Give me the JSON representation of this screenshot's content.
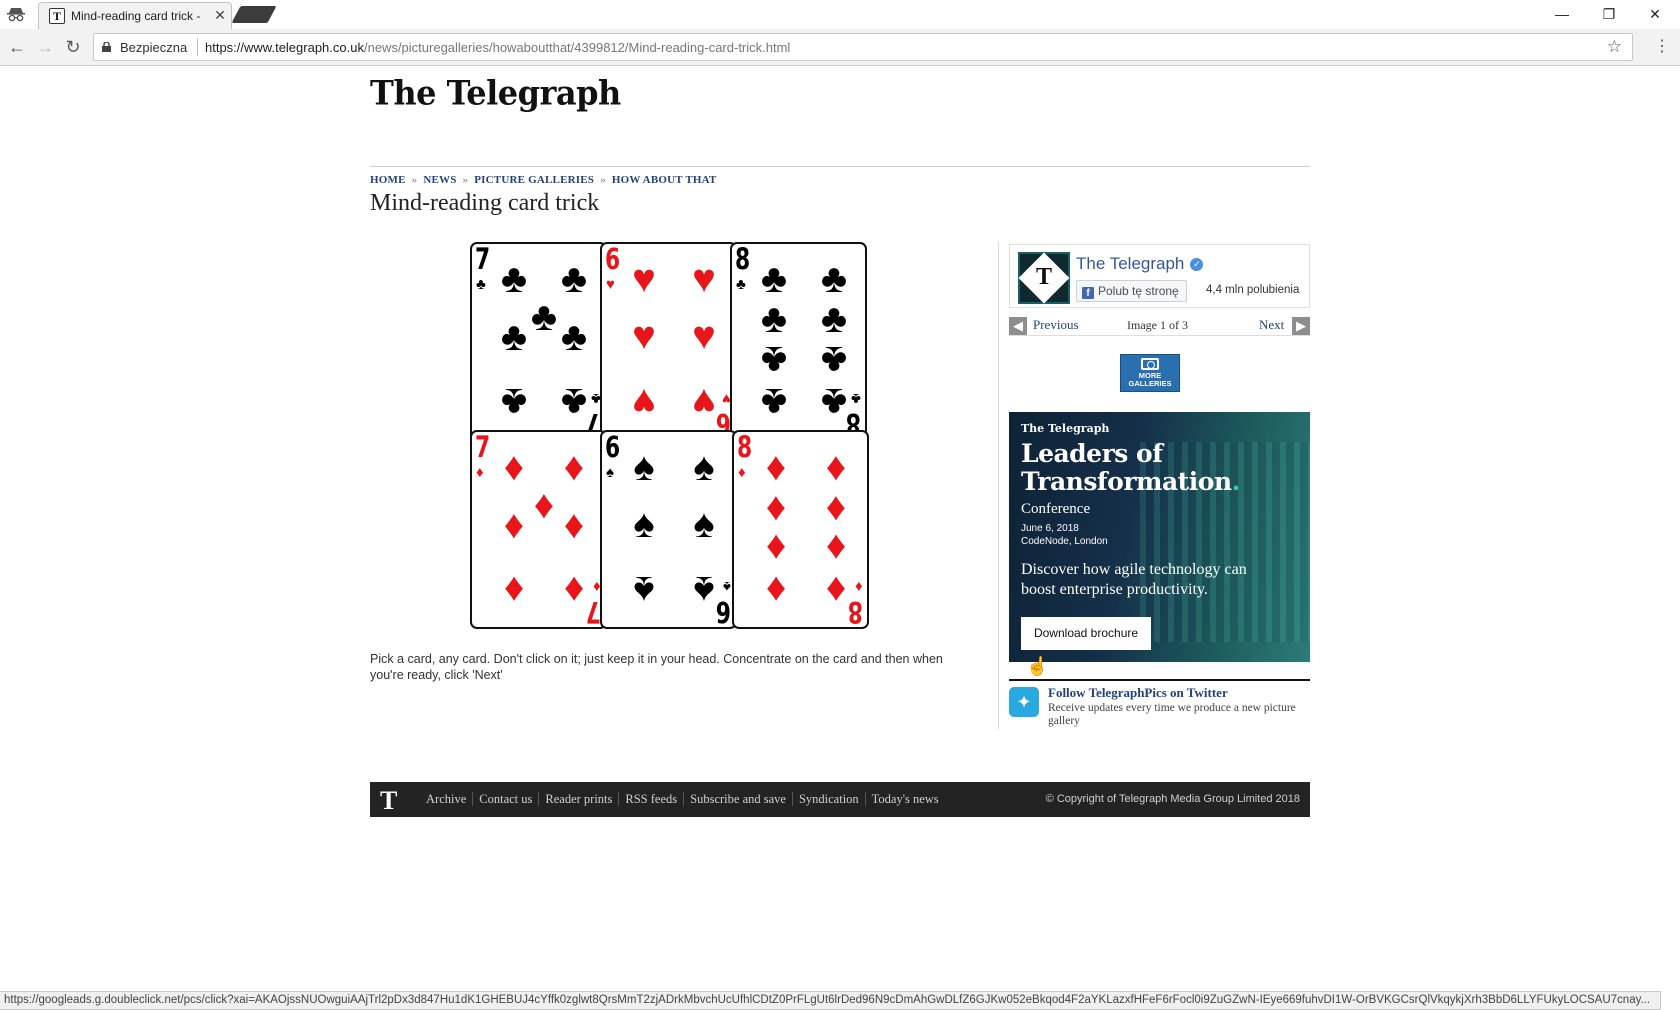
{
  "browser": {
    "tab_title": "Mind-reading card trick - ",
    "tab_close": "✕",
    "secure_label": "Bezpieczna",
    "url_host": "https://www.telegraph.co.uk",
    "url_path": "/news/picturegalleries/howaboutthat/4399812/Mind-reading-card-trick.html",
    "status_url": "https://googleads.g.doubleclick.net/pcs/click?xai=AKAOjssNUOwguiAAjTrl2pDx3d847Hu1dK1GHEBUJ4cYffk0zglwt8QrsMmT2zjADrkMbvchUcUfhlCDtZ0PrFLgUt6lrDed96N9cDmAhGwDLfZ6GJKw052eBkqod4F2aYKLazxfHFeF6rFocl0i9ZuGZwN-IEye669fuhvDI1W-OrBVKGCsrQlVkqykjXrh3BbD6LLYFUkyLOCSAU7cnay..."
  },
  "site": {
    "logo": "The Telegraph",
    "breadcrumb": [
      "HOME",
      "NEWS",
      "PICTURE GALLERIES",
      "HOW ABOUT THAT"
    ],
    "breadcrumb_sep": "»",
    "headline": "Mind-reading card trick",
    "caption": "Pick a card, any card. Don't click on it; just keep it in your head. Concentrate on the card and then when you're ready, click 'Next'"
  },
  "cards": [
    {
      "rank": "7",
      "suit": "♣",
      "color": "#000000"
    },
    {
      "rank": "6",
      "suit": "♥",
      "color": "#e8161b"
    },
    {
      "rank": "8",
      "suit": "♣",
      "color": "#000000"
    },
    {
      "rank": "7",
      "suit": "♦",
      "color": "#e8161b"
    },
    {
      "rank": "6",
      "suit": "♠",
      "color": "#000000"
    },
    {
      "rank": "8",
      "suit": "♦",
      "color": "#e8161b"
    }
  ],
  "facebook": {
    "page_name": "The Telegraph",
    "like_label": "Polub tę stronę",
    "likes_count": "4,4 mln polubienia"
  },
  "pager": {
    "previous": "Previous",
    "count": "Image 1 of 3",
    "next": "Next"
  },
  "more_galleries": "MORE GALLERIES",
  "ad": {
    "brand": "The Telegraph",
    "headline_1": "Leaders of",
    "headline_2": "Transformation",
    "subtitle": "Conference",
    "date": "June 6, 2018",
    "venue": "CodeNode, London",
    "body": "Discover how agile technology can boost enterprise productivity.",
    "cta": "Download brochure"
  },
  "twitter": {
    "title": "Follow TelegraphPics on Twitter",
    "text": "Receive updates every time we produce a new picture gallery"
  },
  "footer": {
    "links": [
      "Archive",
      "Contact us",
      "Reader prints",
      "RSS feeds",
      "Subscribe and save",
      "Syndication",
      "Today's news"
    ],
    "copyright": "© Copyright of Telegraph Media Group Limited 2018"
  },
  "colors": {
    "link_blue": "#22437a",
    "card_red": "#e8161b",
    "footer_bg": "#232323",
    "twitter_blue": "#2aa9e0"
  }
}
